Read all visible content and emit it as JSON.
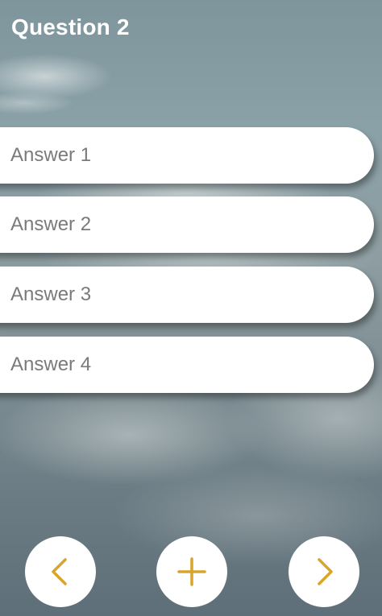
{
  "question": {
    "title": "Question 2"
  },
  "answers": [
    {
      "label": "Answer 1"
    },
    {
      "label": "Answer 2"
    },
    {
      "label": "Answer 3"
    },
    {
      "label": "Answer 4"
    }
  ],
  "toolbar": {
    "prev_icon": "chevron-left-icon",
    "add_icon": "plus-icon",
    "next_icon": "chevron-right-icon"
  },
  "colors": {
    "accent": "#d8a42c",
    "answer_text": "#7a7a7a",
    "title_text": "#ffffff",
    "button_bg": "#ffffff"
  }
}
